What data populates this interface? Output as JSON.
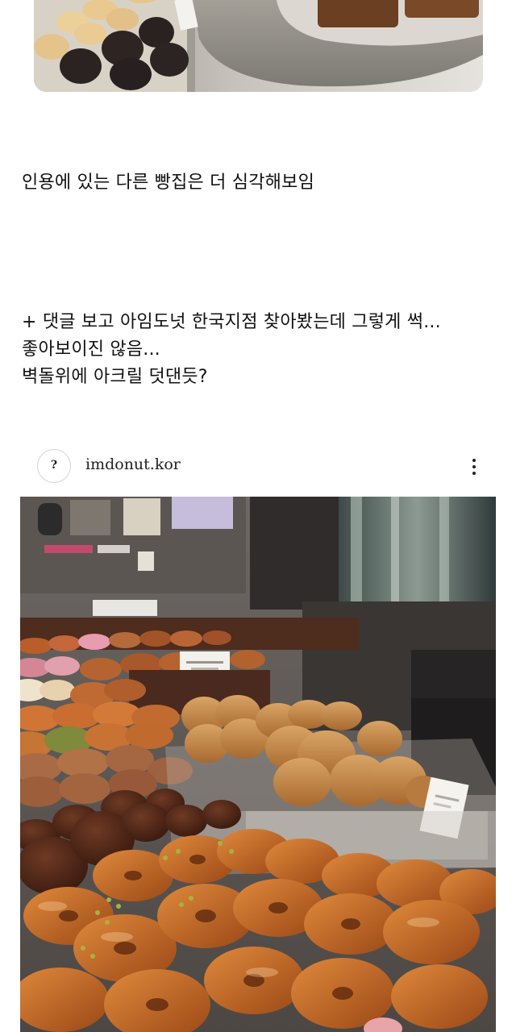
{
  "post": {
    "line1": "인용에 있는 다른 빵집은 더 심각해보임",
    "block2": [
      "+ 댓글 보고 아임도넛 한국지점 찾아봤는데 그렇게 썩...",
      "좋아보이진 않음...",
      "벽돌위에 아크릴 덧댄듯?"
    ]
  },
  "embed": {
    "avatar_glyph": "?",
    "username": "imdonut.kor",
    "more_icon": "vertical-ellipsis-icon"
  },
  "images": {
    "top": "bakery display photo with bread and cookies on stone pedestal",
    "main": "donut shop display counter with glazed donuts on acrylic stands"
  }
}
